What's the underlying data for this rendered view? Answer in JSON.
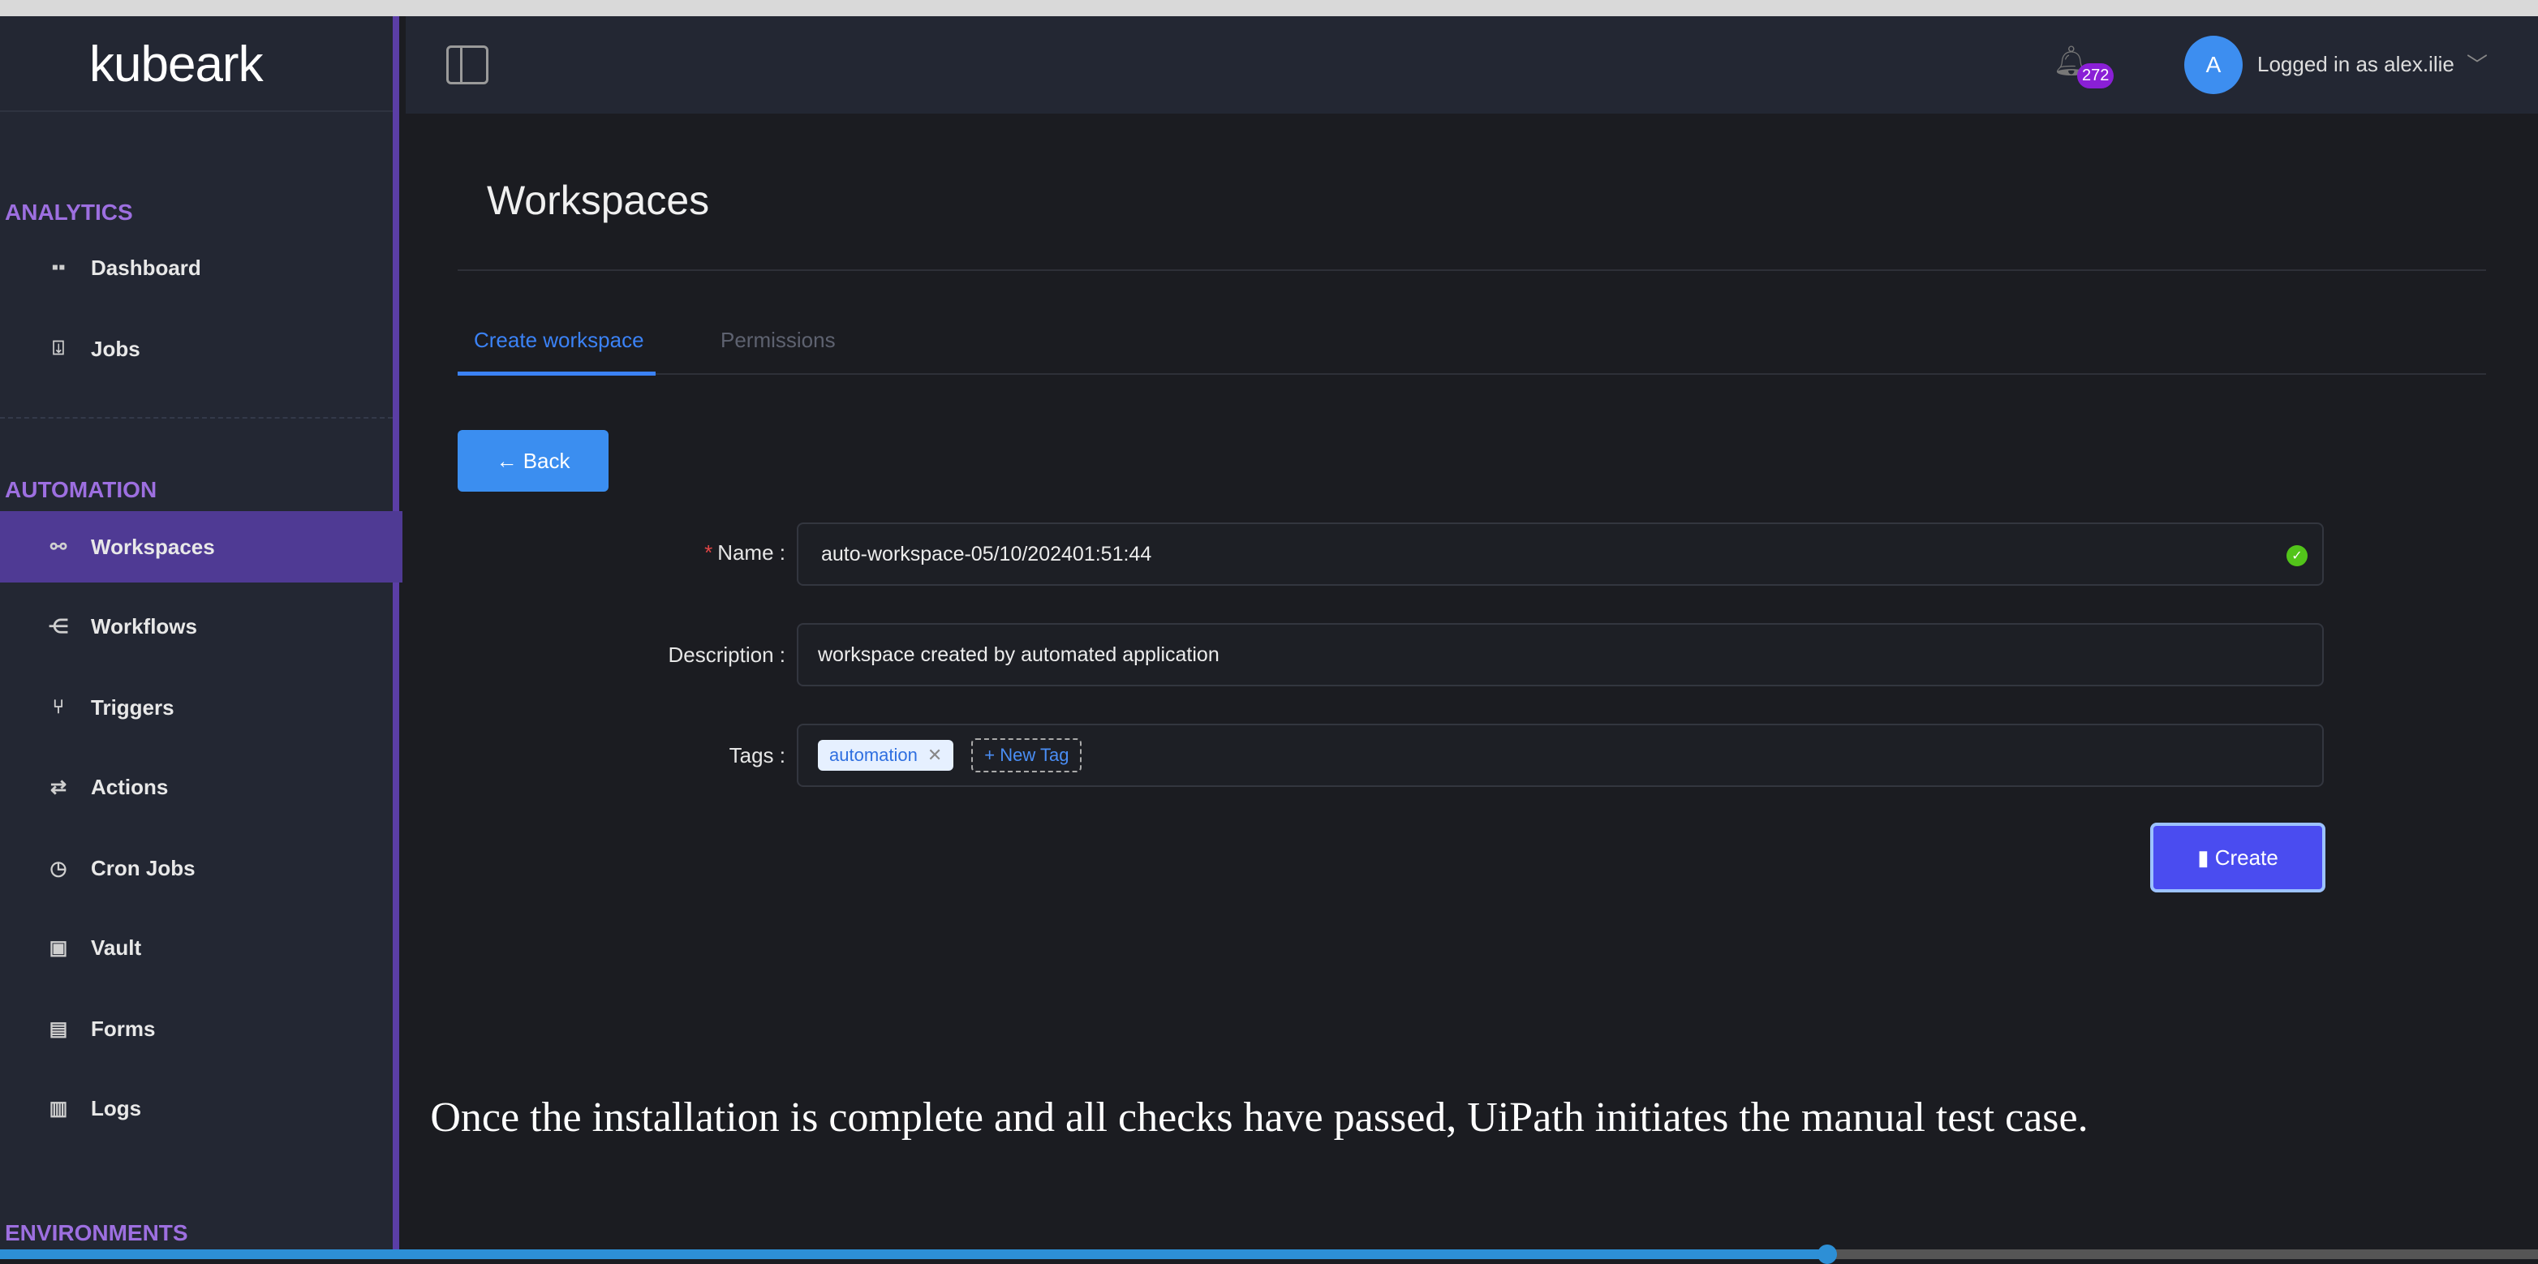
{
  "app": {
    "logo": "kubeark"
  },
  "header": {
    "notification_count": "272",
    "avatar_initial": "A",
    "user_label": "Logged in as alex.ilie"
  },
  "sidebar": {
    "sections": [
      {
        "label": "ANALYTICS",
        "items": [
          {
            "label": "Dashboard",
            "icon": "dashboard-icon"
          },
          {
            "label": "Jobs",
            "icon": "jobs-icon"
          }
        ]
      },
      {
        "label": "AUTOMATION",
        "items": [
          {
            "label": "Workspaces",
            "icon": "workspaces-icon",
            "active": true
          },
          {
            "label": "Workflows",
            "icon": "workflows-icon"
          },
          {
            "label": "Triggers",
            "icon": "triggers-icon"
          },
          {
            "label": "Actions",
            "icon": "actions-icon"
          },
          {
            "label": "Cron Jobs",
            "icon": "clock-icon"
          },
          {
            "label": "Vault",
            "icon": "vault-icon"
          },
          {
            "label": "Forms",
            "icon": "forms-icon"
          },
          {
            "label": "Logs",
            "icon": "logs-icon"
          }
        ]
      },
      {
        "label": "ENVIRONMENTS",
        "items": []
      }
    ]
  },
  "main": {
    "title": "Workspaces",
    "tabs": [
      {
        "label": "Create workspace",
        "active": true
      },
      {
        "label": "Permissions"
      }
    ],
    "back_label": "Back",
    "form": {
      "name_label": "Name :",
      "name_value": "auto-workspace-05/10/202401:51:44",
      "description_label": "Description :",
      "description_value": "workspace created by automated application",
      "tags_label": "Tags :",
      "tags": [
        "automation"
      ],
      "new_tag_label": "New Tag"
    },
    "create_label": "Create"
  },
  "caption": "Once the installation is complete and all checks have passed, UiPath initiates the manual test case.",
  "video_progress_percent": 72,
  "colors": {
    "accent": "#3b8ef0",
    "sidebar_active": "#4f3a94",
    "section": "#9d6fe0",
    "badge": "#8a1fd6"
  }
}
